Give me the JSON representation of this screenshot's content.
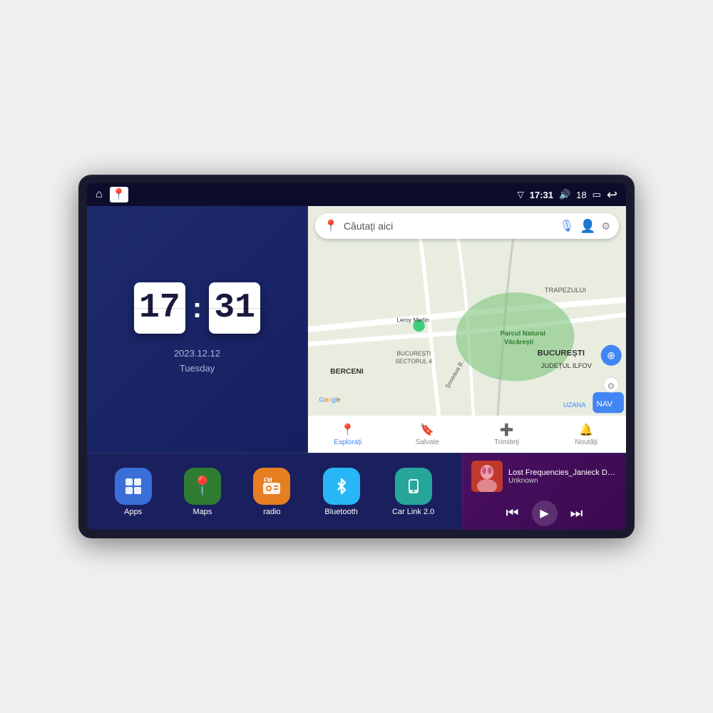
{
  "device": {
    "status_bar": {
      "signal_icon": "▽",
      "time": "17:31",
      "volume_icon": "🔊",
      "volume_level": "18",
      "battery_icon": "🔋",
      "back_icon": "↩"
    },
    "clock": {
      "hour": "17",
      "minute": "31",
      "date": "2023.12.12",
      "day": "Tuesday"
    },
    "map": {
      "search_placeholder": "Căutați aici",
      "nav_items": [
        {
          "label": "Explorați",
          "icon": "📍",
          "active": true
        },
        {
          "label": "Salvate",
          "icon": "🔖",
          "active": false
        },
        {
          "label": "Trimiteți",
          "icon": "⊕",
          "active": false
        },
        {
          "label": "Noutăți",
          "icon": "🔔",
          "active": false
        }
      ]
    },
    "apps": [
      {
        "label": "Apps",
        "icon": "⊞",
        "bg": "#3a6fd8"
      },
      {
        "label": "Maps",
        "icon": "📍",
        "bg": "#e53935"
      },
      {
        "label": "radio",
        "icon": "📻",
        "bg": "#e67e22"
      },
      {
        "label": "Bluetooth",
        "icon": "⚡",
        "bg": "#29b6f6"
      },
      {
        "label": "Car Link 2.0",
        "icon": "📱",
        "bg": "#26a69a"
      }
    ],
    "music": {
      "title": "Lost Frequencies_Janieck Devy-...",
      "artist": "Unknown",
      "thumb_emoji": "🎵"
    }
  }
}
